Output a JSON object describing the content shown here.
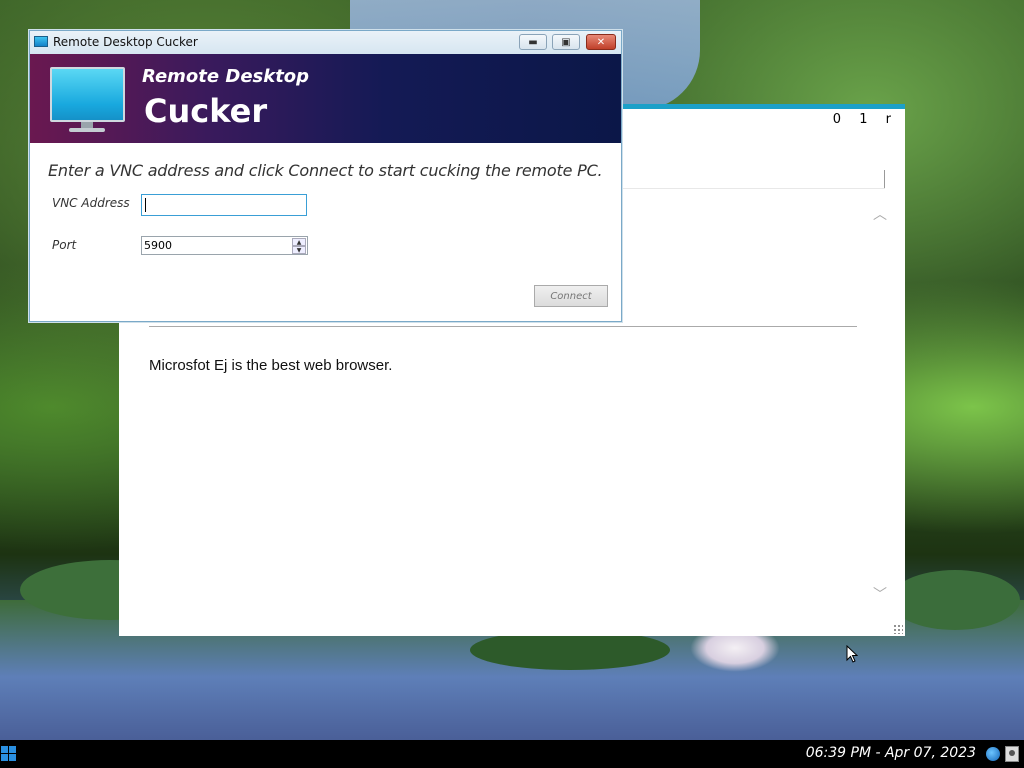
{
  "dialog": {
    "title": "Remote Desktop Cucker",
    "banner_line1": "Remote Desktop",
    "banner_line2": "Cucker",
    "instruction": "Enter a VNC address and click Connect to start cucking the remote PC.",
    "vnc_label": "VNC Address",
    "vnc_value": "",
    "port_label": "Port",
    "port_value": "5900",
    "connect_label": "Connect",
    "minimize_symbol": "▬",
    "maximize_symbol": "▣",
    "close_symbol": "✕"
  },
  "browser": {
    "window_controls": [
      "0",
      "1",
      "r"
    ],
    "body_text": "Microsfot Ej is the best web browser.",
    "scroll_up_symbol": "︿",
    "scroll_down_symbol": "﹀"
  },
  "taskbar": {
    "clock": "06:39 PM - Apr 07, 2023",
    "icons": [
      "start-icon",
      "globe-icon",
      "user-icon"
    ]
  },
  "colors": {
    "accent": "#1ca0c8",
    "banner_start": "#6a1850",
    "banner_end": "#0b1748",
    "taskbar": "#000000"
  }
}
